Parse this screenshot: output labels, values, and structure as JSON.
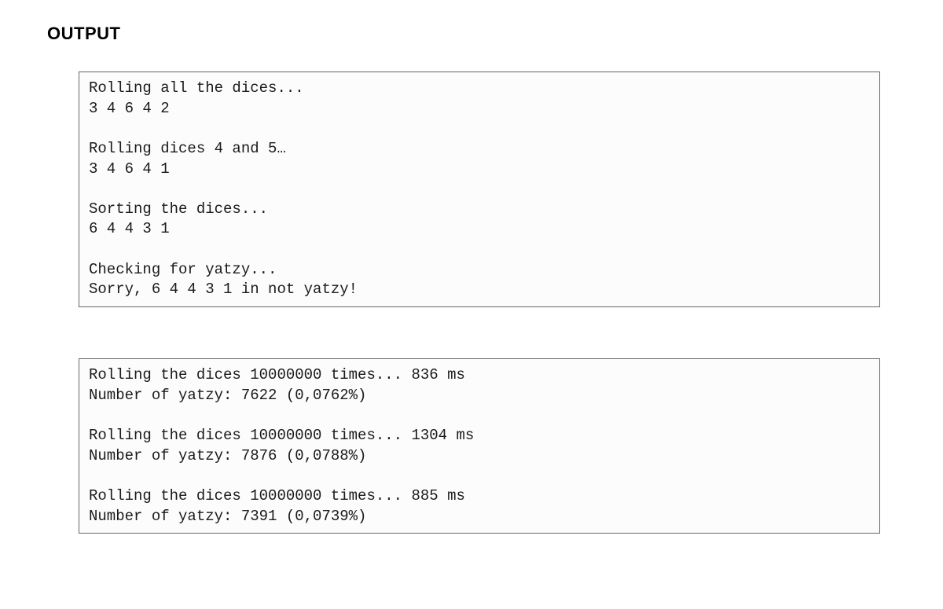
{
  "heading": "OUTPUT",
  "block1": "Rolling all the dices...\n3 4 6 4 2\n\nRolling dices 4 and 5…\n3 4 6 4 1\n\nSorting the dices...\n6 4 4 3 1\n\nChecking for yatzy...\nSorry, 6 4 4 3 1 in not yatzy!",
  "block2": "Rolling the dices 10000000 times... 836 ms\nNumber of yatzy: 7622 (0,0762%)\n\nRolling the dices 10000000 times... 1304 ms\nNumber of yatzy: 7876 (0,0788%)\n\nRolling the dices 10000000 times... 885 ms\nNumber of yatzy: 7391 (0,0739%)"
}
